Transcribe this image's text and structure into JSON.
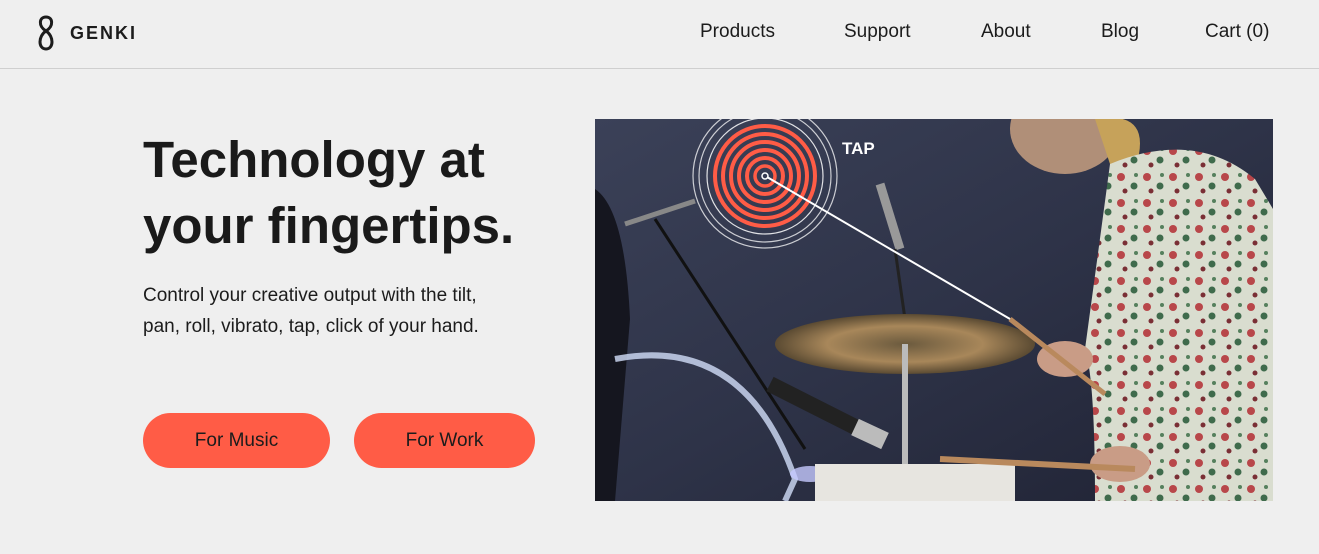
{
  "header": {
    "logo_text": "GENKI",
    "nav": [
      {
        "label": "Products"
      },
      {
        "label": "Support"
      },
      {
        "label": "About"
      },
      {
        "label": "Blog"
      },
      {
        "label": "Cart (0)"
      }
    ]
  },
  "hero": {
    "title_line1": "Technology at",
    "title_line2": "your fingertips.",
    "subtitle": "Control your creative output with the tilt, pan, roll, vibrato, tap, click of your hand.",
    "buttons": [
      {
        "label": "For Music"
      },
      {
        "label": "For Work"
      }
    ]
  },
  "video": {
    "overlay_label": "TAP"
  },
  "colors": {
    "accent": "#ff5c46",
    "background": "#efefef",
    "text": "#1c1c1c"
  }
}
